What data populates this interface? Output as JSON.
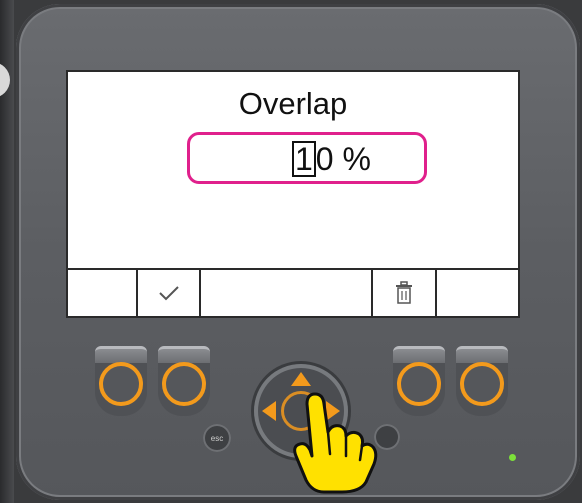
{
  "screen": {
    "title": "Overlap",
    "value": {
      "cursor_digit": "1",
      "rest": "0 %"
    },
    "softkeys": [
      {
        "id": "softkey-1",
        "label": ""
      },
      {
        "id": "softkey-2",
        "label": "",
        "icon": "checkmark-icon"
      },
      {
        "id": "softkey-3",
        "label": ""
      },
      {
        "id": "softkey-4",
        "label": "",
        "icon": "trash-icon"
      },
      {
        "id": "softkey-5",
        "label": ""
      }
    ]
  },
  "hardware": {
    "esc_label": "esc",
    "accent_color": "#f39a1c",
    "highlight_color": "#e0208c",
    "led_color": "#7de13a"
  }
}
